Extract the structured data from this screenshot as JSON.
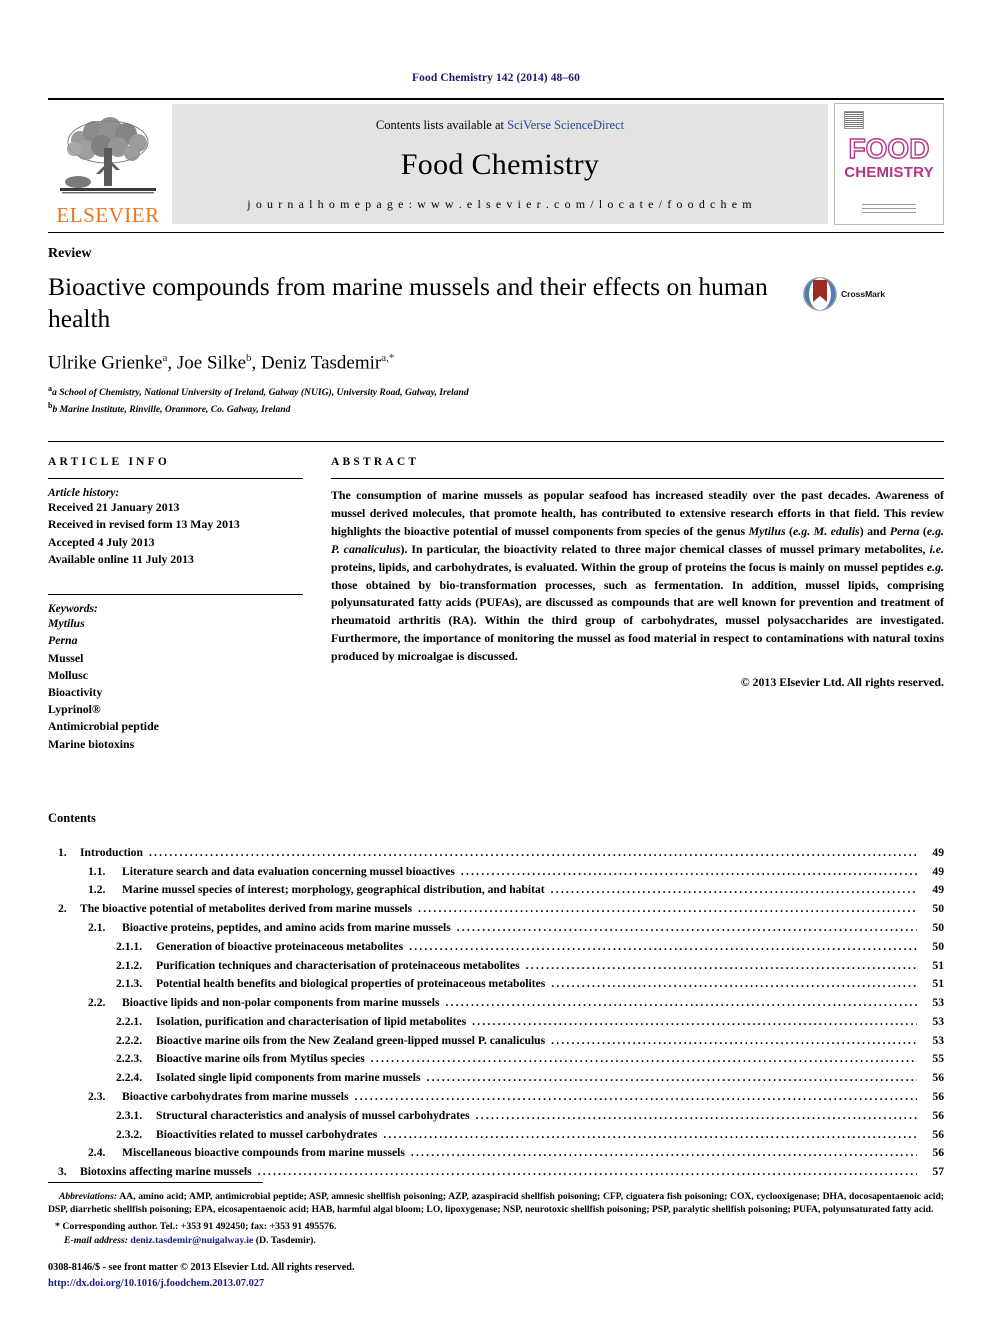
{
  "running_head": "Food Chemistry 142 (2014) 48–60",
  "masthead": {
    "contents_prefix": "Contents lists available at ",
    "sciencedirect": "SciVerse ScienceDirect",
    "journal_title": "Food Chemistry",
    "homepage": "j o u r n a l   h o m e p a g e :   w w w . e l s e v i e r . c o m / l o c a t e / f o o d c h e m",
    "elsevier_wordmark": "ELSEVIER",
    "cover": {
      "line1": "FOOD",
      "line2": "CHEMISTRY"
    }
  },
  "article": {
    "doctype": "Review",
    "title": "Bioactive compounds from marine mussels and their effects on human health",
    "crossmark_label": "CrossMark",
    "authors_html": "Ulrike Grienke ᵃ, Joe Silke ᵇ, Deniz Tasdemir ᵃ,*",
    "affiliations": [
      "a School of Chemistry, National University of Ireland, Galway (NUIG), University Road, Galway, Ireland",
      "b Marine Institute, Rinville, Oranmore, Co. Galway, Ireland"
    ]
  },
  "article_info": {
    "heading": "ARTICLE INFO",
    "history_label": "Article history:",
    "history": [
      "Received 21 January 2013",
      "Received in revised form 13 May 2013",
      "Accepted 4 July 2013",
      "Available online 11 July 2013"
    ],
    "keywords_label": "Keywords:",
    "keywords": [
      "Mytilus",
      "Perna",
      "Mussel",
      "Mollusc",
      "Bioactivity",
      "Lyprinol®",
      "Antimicrobial peptide",
      "Marine biotoxins"
    ],
    "keywords_italic": [
      true,
      true,
      false,
      false,
      false,
      false,
      false,
      false
    ]
  },
  "abstract": {
    "heading": "ABSTRACT",
    "text": "The consumption of marine mussels as popular seafood has increased steadily over the past decades. Awareness of mussel derived molecules, that promote health, has contributed to extensive research efforts in that field. This review highlights the bioactive potential of mussel components from species of the genus Mytilus (e.g. M. edulis) and Perna (e.g. P. canaliculus). In particular, the bioactivity related to three major chemical classes of mussel primary metabolites, i.e. proteins, lipids, and carbohydrates, is evaluated. Within the group of proteins the focus is mainly on mussel peptides e.g. those obtained by bio-transformation processes, such as fermentation. In addition, mussel lipids, comprising polyunsaturated fatty acids (PUFAs), are discussed as compounds that are well known for prevention and treatment of rheumatoid arthritis (RA). Within the third group of carbohydrates, mussel polysaccharides are investigated. Furthermore, the importance of monitoring the mussel as food material in respect to contaminations with natural toxins produced by microalgae is discussed.",
    "copyright": "© 2013 Elsevier Ltd. All rights reserved."
  },
  "contents": {
    "title": "Contents",
    "entries": [
      {
        "level": 1,
        "number": "1.",
        "label": "Introduction",
        "page": "49"
      },
      {
        "level": 2,
        "number": "1.1.",
        "label": "Literature search and data evaluation concerning mussel bioactives",
        "page": "49"
      },
      {
        "level": 2,
        "number": "1.2.",
        "label": "Marine mussel species of interest; morphology, geographical distribution, and habitat",
        "page": "49"
      },
      {
        "level": 1,
        "number": "2.",
        "label": "The bioactive potential of metabolites derived from marine mussels",
        "page": "50"
      },
      {
        "level": 2,
        "number": "2.1.",
        "label": "Bioactive proteins, peptides, and amino acids from marine mussels",
        "page": "50"
      },
      {
        "level": 3,
        "number": "2.1.1.",
        "label": "Generation of bioactive proteinaceous metabolites",
        "page": "50"
      },
      {
        "level": 3,
        "number": "2.1.2.",
        "label": "Purification techniques and characterisation of proteinaceous metabolites",
        "page": "51"
      },
      {
        "level": 3,
        "number": "2.1.3.",
        "label": "Potential health benefits and biological properties of proteinaceous metabolites",
        "page": "51"
      },
      {
        "level": 2,
        "number": "2.2.",
        "label": "Bioactive lipids and non-polar components from marine mussels",
        "page": "53"
      },
      {
        "level": 3,
        "number": "2.2.1.",
        "label": "Isolation, purification and characterisation of lipid metabolites",
        "page": "53"
      },
      {
        "level": 3,
        "number": "2.2.2.",
        "label": "Bioactive marine oils from the New Zealand green-lipped mussel P. canaliculus",
        "page": "53"
      },
      {
        "level": 3,
        "number": "2.2.3.",
        "label": "Bioactive marine oils from Mytilus species",
        "page": "55"
      },
      {
        "level": 3,
        "number": "2.2.4.",
        "label": "Isolated single lipid components from marine mussels",
        "page": "56"
      },
      {
        "level": 2,
        "number": "2.3.",
        "label": "Bioactive carbohydrates from marine mussels",
        "page": "56"
      },
      {
        "level": 3,
        "number": "2.3.1.",
        "label": "Structural characteristics and analysis of mussel carbohydrates",
        "page": "56"
      },
      {
        "level": 3,
        "number": "2.3.2.",
        "label": "Bioactivities related to mussel carbohydrates",
        "page": "56"
      },
      {
        "level": 2,
        "number": "2.4.",
        "label": "Miscellaneous bioactive compounds from marine mussels",
        "page": "56"
      },
      {
        "level": 1,
        "number": "3.",
        "label": "Biotoxins affecting marine mussels",
        "page": "57"
      }
    ]
  },
  "footnotes": {
    "abbreviations_label": "Abbreviations:",
    "abbreviations_text": "AA, amino acid; AMP, antimicrobial peptide; ASP, amnesic shellfish poisoning; AZP, azaspiracid shellfish poisoning; CFP, ciguatera fish poisoning; COX, cyclooxigenase; DHA, docosapentaenoic acid; DSP, diarrhetic shellfish poisoning; EPA, eicosapentaenoic acid; HAB, harmful algal bloom; LO, lipoxygenase; NSP, neurotoxic shellfish poisoning; PSP, paralytic shellfish poisoning; PUFA, polyunsaturated fatty acid.",
    "corresponding": "* Corresponding author. Tel.: +353 91 492450; fax: +353 91 495576.",
    "email_label": "E-mail address:",
    "email": "deniz.tasdemir@nuigalway.ie",
    "email_suffix": "(D. Tasdemir).",
    "issn_line": "0308-8146/$ - see front matter © 2013 Elsevier Ltd. All rights reserved.",
    "doi_line": "http://dx.doi.org/10.1016/j.foodchem.2013.07.027"
  },
  "colors": {
    "running_head": "#1a1a6e",
    "elsevier_orange": "#E87722",
    "cover_magenta": "#b5338a",
    "link_blue": "#1a1a8e",
    "sciencedirect_blue": "#2a4b8d"
  }
}
